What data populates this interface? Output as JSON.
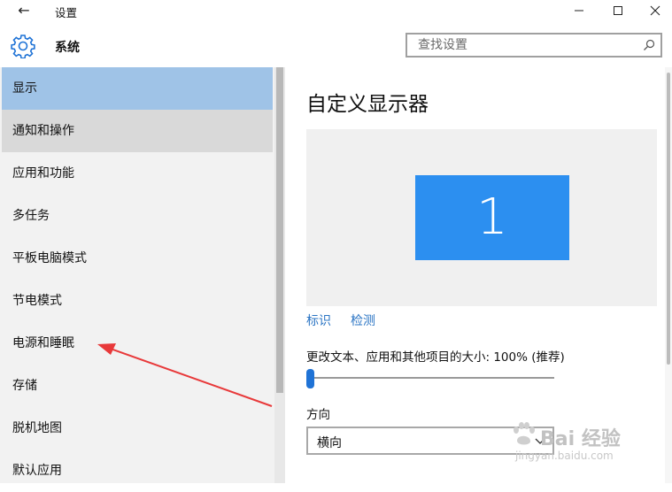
{
  "window": {
    "title": "设置",
    "back_glyph": "←"
  },
  "header": {
    "title": "系统",
    "search_placeholder": "查找设置"
  },
  "sidebar": {
    "items": [
      {
        "label": "显示",
        "state": "selected"
      },
      {
        "label": "通知和操作",
        "state": "hover"
      },
      {
        "label": "应用和功能",
        "state": "normal"
      },
      {
        "label": "多任务",
        "state": "normal"
      },
      {
        "label": "平板电脑模式",
        "state": "normal"
      },
      {
        "label": "节电模式",
        "state": "normal"
      },
      {
        "label": "电源和睡眠",
        "state": "normal"
      },
      {
        "label": "存储",
        "state": "normal"
      },
      {
        "label": "脱机地图",
        "state": "normal"
      },
      {
        "label": "默认应用",
        "state": "normal"
      }
    ]
  },
  "main": {
    "title": "自定义显示器",
    "monitor_number": "1",
    "identify_link": "标识",
    "detect_link": "检测",
    "scale_label": "更改文本、应用和其他项目的大小: 100% (推荐)",
    "scale_value": 0,
    "orientation_label": "方向",
    "orientation_value": "横向"
  },
  "watermark": {
    "text": "Bai 经验",
    "url": "jingyan.baidu.com"
  },
  "colors": {
    "accent": "#2c8ff0",
    "selected_bg": "#9fc3e7",
    "link": "#2a74c4",
    "annotation_arrow": "#e8393a"
  },
  "icons": {
    "back": "back-arrow-icon",
    "minimize": "minimize-icon",
    "maximize": "maximize-icon",
    "close": "close-icon",
    "settings": "gear-icon",
    "search": "search-icon",
    "dropdown": "chevron-down-icon"
  }
}
